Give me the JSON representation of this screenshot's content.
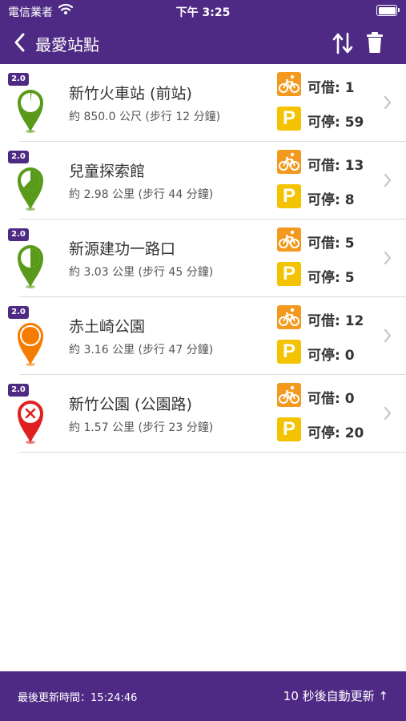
{
  "status_bar": {
    "carrier": "電信業者",
    "time": "下午 3:25"
  },
  "nav": {
    "title": "最愛站點",
    "back_icon": "chevron-left-icon",
    "sort_icon": "sort-arrows-icon",
    "delete_icon": "trash-icon"
  },
  "stations": [
    {
      "version": "2.0",
      "name": "新竹火車站 (前站)",
      "distance": "約 850.0 公尺 (步行 12 分鐘)",
      "rent_label": "可借: 1",
      "return_label": "可停: 59",
      "pin_state": "green-low",
      "rent_fraction": 0.02
    },
    {
      "version": "2.0",
      "name": "兒童探索館",
      "distance": "約 2.98 公里 (步行 44 分鐘)",
      "rent_label": "可借: 13",
      "return_label": "可停: 8",
      "pin_state": "green-partial",
      "rent_fraction": 0.62
    },
    {
      "version": "2.0",
      "name": "新源建功一路口",
      "distance": "約 3.03 公里 (步行 45 分鐘)",
      "rent_label": "可借: 5",
      "return_label": "可停: 5",
      "pin_state": "green-half",
      "rent_fraction": 0.5
    },
    {
      "version": "2.0",
      "name": "赤土崎公園",
      "distance": "約 3.16 公里 (步行 47 分鐘)",
      "rent_label": "可借: 12",
      "return_label": "可停: 0",
      "pin_state": "orange-full",
      "rent_fraction": 1.0
    },
    {
      "version": "2.0",
      "name": "新竹公園 (公園路)",
      "distance": "約 1.57 公里 (步行 23 分鐘)",
      "rent_label": "可借: 0",
      "return_label": "可停: 20",
      "pin_state": "red-empty",
      "rent_fraction": 0
    }
  ],
  "footer": {
    "last_update": "最後更新時間：15:24:46",
    "auto_refresh": "10 秒後自動更新 ↑"
  },
  "colors": {
    "brand_purple": "#4e2a84",
    "bike_orange": "#f39a1e",
    "parking_yellow": "#f3c300",
    "pin_green": "#5a9a1a",
    "pin_orange": "#f57c00",
    "pin_red": "#e02020"
  }
}
